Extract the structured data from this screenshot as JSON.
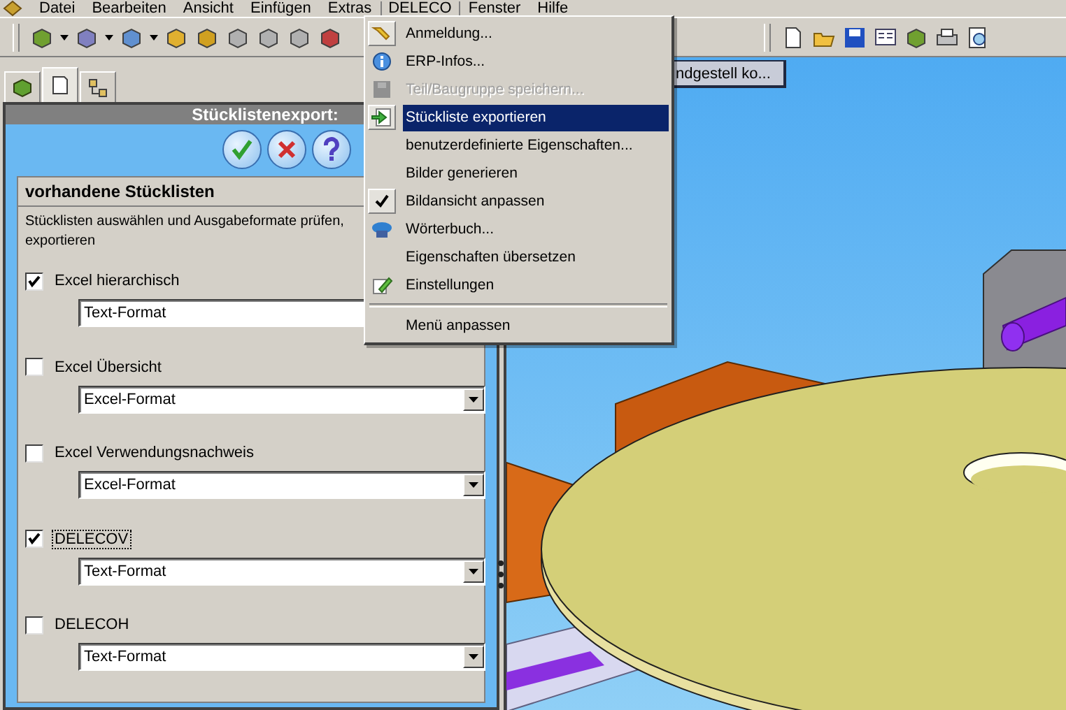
{
  "menu_bar": [
    {
      "label": "Datei",
      "selected": false
    },
    {
      "label": "Bearbeiten",
      "selected": false
    },
    {
      "label": "Ansicht",
      "selected": false
    },
    {
      "label": "Einfügen",
      "selected": false
    },
    {
      "label": "Extras",
      "selected": false
    },
    {
      "label": "DELECO",
      "selected": true
    },
    {
      "label": "Fenster",
      "selected": false
    },
    {
      "label": "Hilfe",
      "selected": false
    }
  ],
  "panel_tabs": [
    {
      "selected": false
    },
    {
      "selected": true
    },
    {
      "selected": false
    }
  ],
  "panel": {
    "title": "Stücklistenexport:",
    "group_title": "vorhandene Stücklisten",
    "description": "Stücklisten auswählen und Ausgabeformate prüfen, exportieren",
    "exports": [
      {
        "label": "Excel hierarchisch",
        "checked": true,
        "focused": false,
        "format": "Text-Format"
      },
      {
        "label": "Excel Übersicht",
        "checked": false,
        "focused": false,
        "format": "Excel-Format"
      },
      {
        "label": "Excel Verwendungsnachweis",
        "checked": false,
        "focused": false,
        "format": "Excel-Format"
      },
      {
        "label": "DELECOV",
        "checked": true,
        "focused": true,
        "format": "Text-Format"
      },
      {
        "label": "DELECOH",
        "checked": false,
        "focused": false,
        "format": "Text-Format"
      }
    ]
  },
  "document_tab": {
    "label": "ndgestell ko..."
  },
  "deleco_menu": [
    {
      "kind": "icon",
      "label": "Anmeldung...",
      "disabled": false,
      "selected": false
    },
    {
      "kind": "icon",
      "label": "ERP-Infos...",
      "disabled": false,
      "selected": false
    },
    {
      "kind": "icon",
      "label": "Teil/Baugruppe speichern...",
      "disabled": true,
      "selected": false
    },
    {
      "kind": "icon",
      "label": "Stückliste exportieren",
      "disabled": false,
      "selected": true
    },
    {
      "kind": "plain",
      "label": "benutzerdefinierte Eigenschaften...",
      "disabled": false,
      "selected": false
    },
    {
      "kind": "plain",
      "label": "Bilder generieren",
      "disabled": false,
      "selected": false
    },
    {
      "kind": "check",
      "label": "Bildansicht anpassen",
      "checked": true,
      "disabled": false,
      "selected": false
    },
    {
      "kind": "icon",
      "label": "Wörterbuch...",
      "disabled": false,
      "selected": false
    },
    {
      "kind": "plain",
      "label": "Eigenschaften übersetzen",
      "disabled": false,
      "selected": false
    },
    {
      "kind": "icon",
      "label": "Einstellungen",
      "disabled": false,
      "selected": false
    },
    {
      "kind": "separator"
    },
    {
      "kind": "plain",
      "label": "Menü anpassen",
      "disabled": false,
      "selected": false
    }
  ]
}
